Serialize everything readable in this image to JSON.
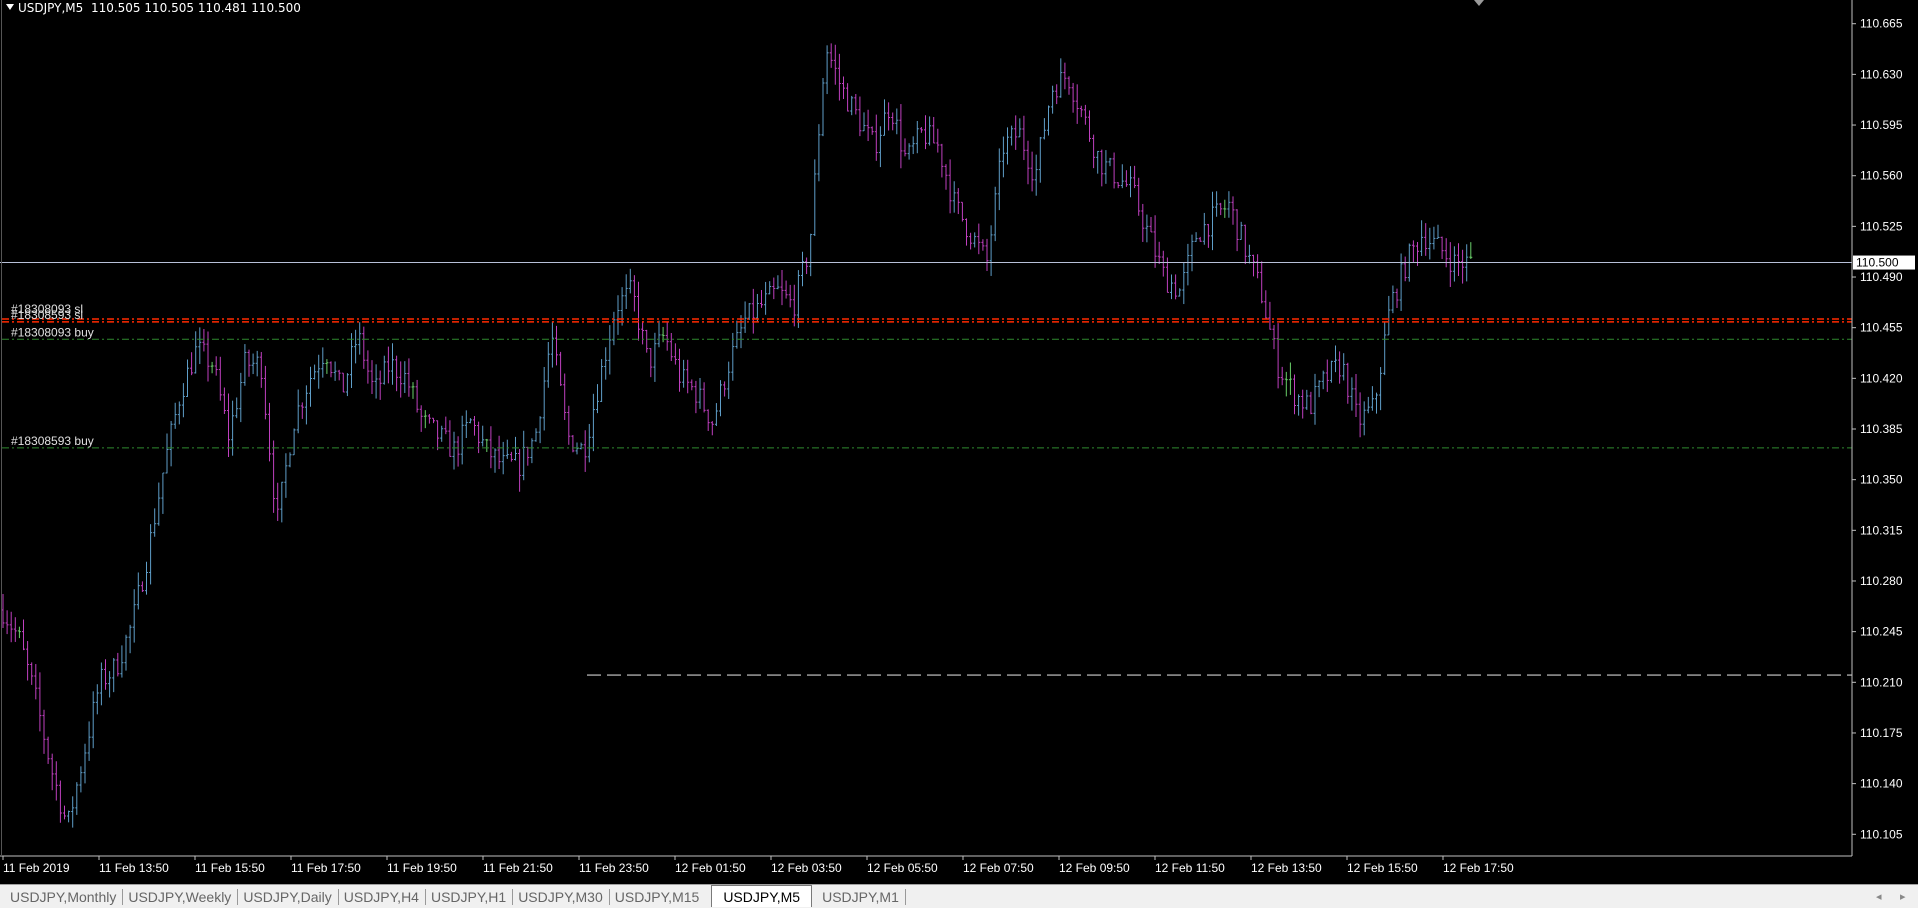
{
  "window": {
    "symbol_title": "USDJPY,M5",
    "ohlc": "110.505 110.505 110.481 110.500"
  },
  "colors": {
    "background": "#000000",
    "axis": "#c0c0c0",
    "bar_up": "#5f9ec8",
    "bar_down": "#c040c0",
    "bar_flat": "#6ad06a",
    "bid_line": "#b8c0d8",
    "sl_line": "#ff2a00",
    "buy_line": "#2f8a2f",
    "hline_dashed": "#d0d0d0"
  },
  "price_axis": {
    "min": 110.09,
    "max": 110.68,
    "labels": [
      "110.665",
      "110.630",
      "110.595",
      "110.560",
      "110.525",
      "110.490",
      "110.455",
      "110.420",
      "110.385",
      "110.350",
      "110.315",
      "110.280",
      "110.245",
      "110.210",
      "110.175",
      "110.140",
      "110.105"
    ],
    "current_price": "110.500"
  },
  "time_axis": {
    "labels": [
      "11 Feb 2019",
      "11 Feb 13:50",
      "11 Feb 15:50",
      "11 Feb 17:50",
      "11 Feb 19:50",
      "11 Feb 21:50",
      "11 Feb 23:50",
      "12 Feb 01:50",
      "12 Feb 03:50",
      "12 Feb 05:50",
      "12 Feb 07:50",
      "12 Feb 09:50",
      "12 Feb 11:50",
      "12 Feb 13:50",
      "12 Feb 15:50",
      "12 Feb 17:50"
    ]
  },
  "order_lines": [
    {
      "label": "#18308093 sl",
      "price": 110.461,
      "kind": "sl"
    },
    {
      "label": "#18308593 sl",
      "price": 110.459,
      "kind": "sl"
    },
    {
      "label": "#18308093 buy",
      "price": 110.447,
      "kind": "buy"
    },
    {
      "label": "#18308593 buy",
      "price": 110.372,
      "kind": "buy"
    }
  ],
  "horizontal_line": {
    "price": 110.215,
    "style": "dashed"
  },
  "chart_data": {
    "type": "ohlc",
    "timeframe": "M5",
    "close_anchors": [
      110.26,
      110.24,
      110.2,
      110.15,
      110.11,
      110.16,
      110.21,
      110.22,
      110.25,
      110.3,
      110.36,
      110.41,
      110.44,
      110.43,
      110.38,
      110.43,
      110.43,
      110.32,
      110.39,
      110.42,
      110.44,
      110.41,
      110.45,
      110.41,
      110.43,
      110.42,
      110.39,
      110.38,
      110.37,
      110.39,
      110.37,
      110.36,
      110.36,
      110.38,
      110.45,
      110.38,
      110.37,
      110.42,
      110.47,
      110.48,
      110.43,
      110.45,
      110.42,
      110.41,
      110.39,
      110.43,
      110.46,
      110.47,
      110.48,
      110.47,
      110.51,
      110.65,
      110.62,
      110.6,
      110.58,
      110.61,
      110.57,
      110.59,
      110.58,
      110.54,
      110.52,
      110.5,
      110.58,
      110.59,
      110.56,
      110.62,
      110.63,
      110.6,
      110.57,
      110.56,
      110.55,
      110.52,
      110.49,
      110.48,
      110.52,
      110.53,
      110.54,
      110.51,
      110.48,
      110.43,
      110.41,
      110.4,
      110.42,
      110.43,
      110.39,
      110.4,
      110.47,
      110.5,
      110.52,
      110.51,
      110.5,
      110.5
    ]
  },
  "tabs": [
    {
      "label": "USDJPY,Monthly",
      "active": false
    },
    {
      "label": "USDJPY,Weekly",
      "active": false
    },
    {
      "label": "USDJPY,Daily",
      "active": false
    },
    {
      "label": "USDJPY,H4",
      "active": false
    },
    {
      "label": "USDJPY,H1",
      "active": false
    },
    {
      "label": "USDJPY,M30",
      "active": false
    },
    {
      "label": "USDJPY,M15",
      "active": false
    },
    {
      "label": "USDJPY,M5",
      "active": true
    },
    {
      "label": "USDJPY,M1",
      "active": false
    }
  ],
  "tab_scroll": {
    "left_icon": "scroll-left-icon",
    "right_icon": "scroll-right-icon"
  }
}
